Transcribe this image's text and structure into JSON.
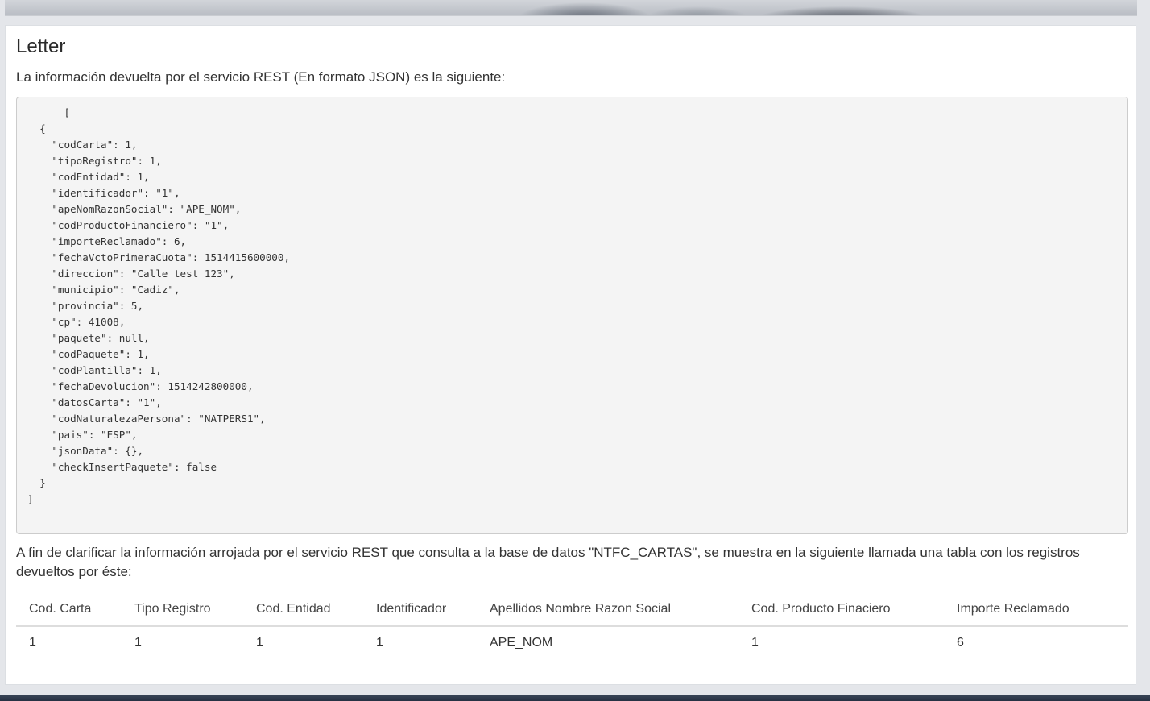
{
  "letter": {
    "title": "Letter",
    "intro": "La información devuelta por el servicio REST (En formato JSON) es la siguiente:",
    "json_response": "      [\n  {\n    \"codCarta\": 1,\n    \"tipoRegistro\": 1,\n    \"codEntidad\": 1,\n    \"identificador\": \"1\",\n    \"apeNomRazonSocial\": \"APE_NOM\",\n    \"codProductoFinanciero\": \"1\",\n    \"importeReclamado\": 6,\n    \"fechaVctoPrimeraCuota\": 1514415600000,\n    \"direccion\": \"Calle test 123\",\n    \"municipio\": \"Cadiz\",\n    \"provincia\": 5,\n    \"cp\": 41008,\n    \"paquete\": null,\n    \"codPaquete\": 1,\n    \"codPlantilla\": 1,\n    \"fechaDevolucion\": 1514242800000,\n    \"datosCarta\": \"1\",\n    \"codNaturalezaPersona\": \"NATPERS1\",\n    \"pais\": \"ESP\",\n    \"jsonData\": {},\n    \"checkInsertPaquete\": false\n  }\n]",
    "explanation": "A fin de clarificar la información arrojada por el servicio REST que consulta a la base de datos \"NTFC_CARTAS\", se muestra en la siguiente llamada una tabla con los registros devueltos por éste:",
    "table": {
      "columns": [
        "Cod. Carta",
        "Tipo Registro",
        "Cod. Entidad",
        "Identificador",
        "Apellidos Nombre Razon Social",
        "Cod. Producto Finaciero",
        "Importe Reclamado"
      ],
      "rows": [
        [
          "1",
          "1",
          "1",
          "1",
          "APE_NOM",
          "1",
          "6"
        ]
      ]
    }
  }
}
